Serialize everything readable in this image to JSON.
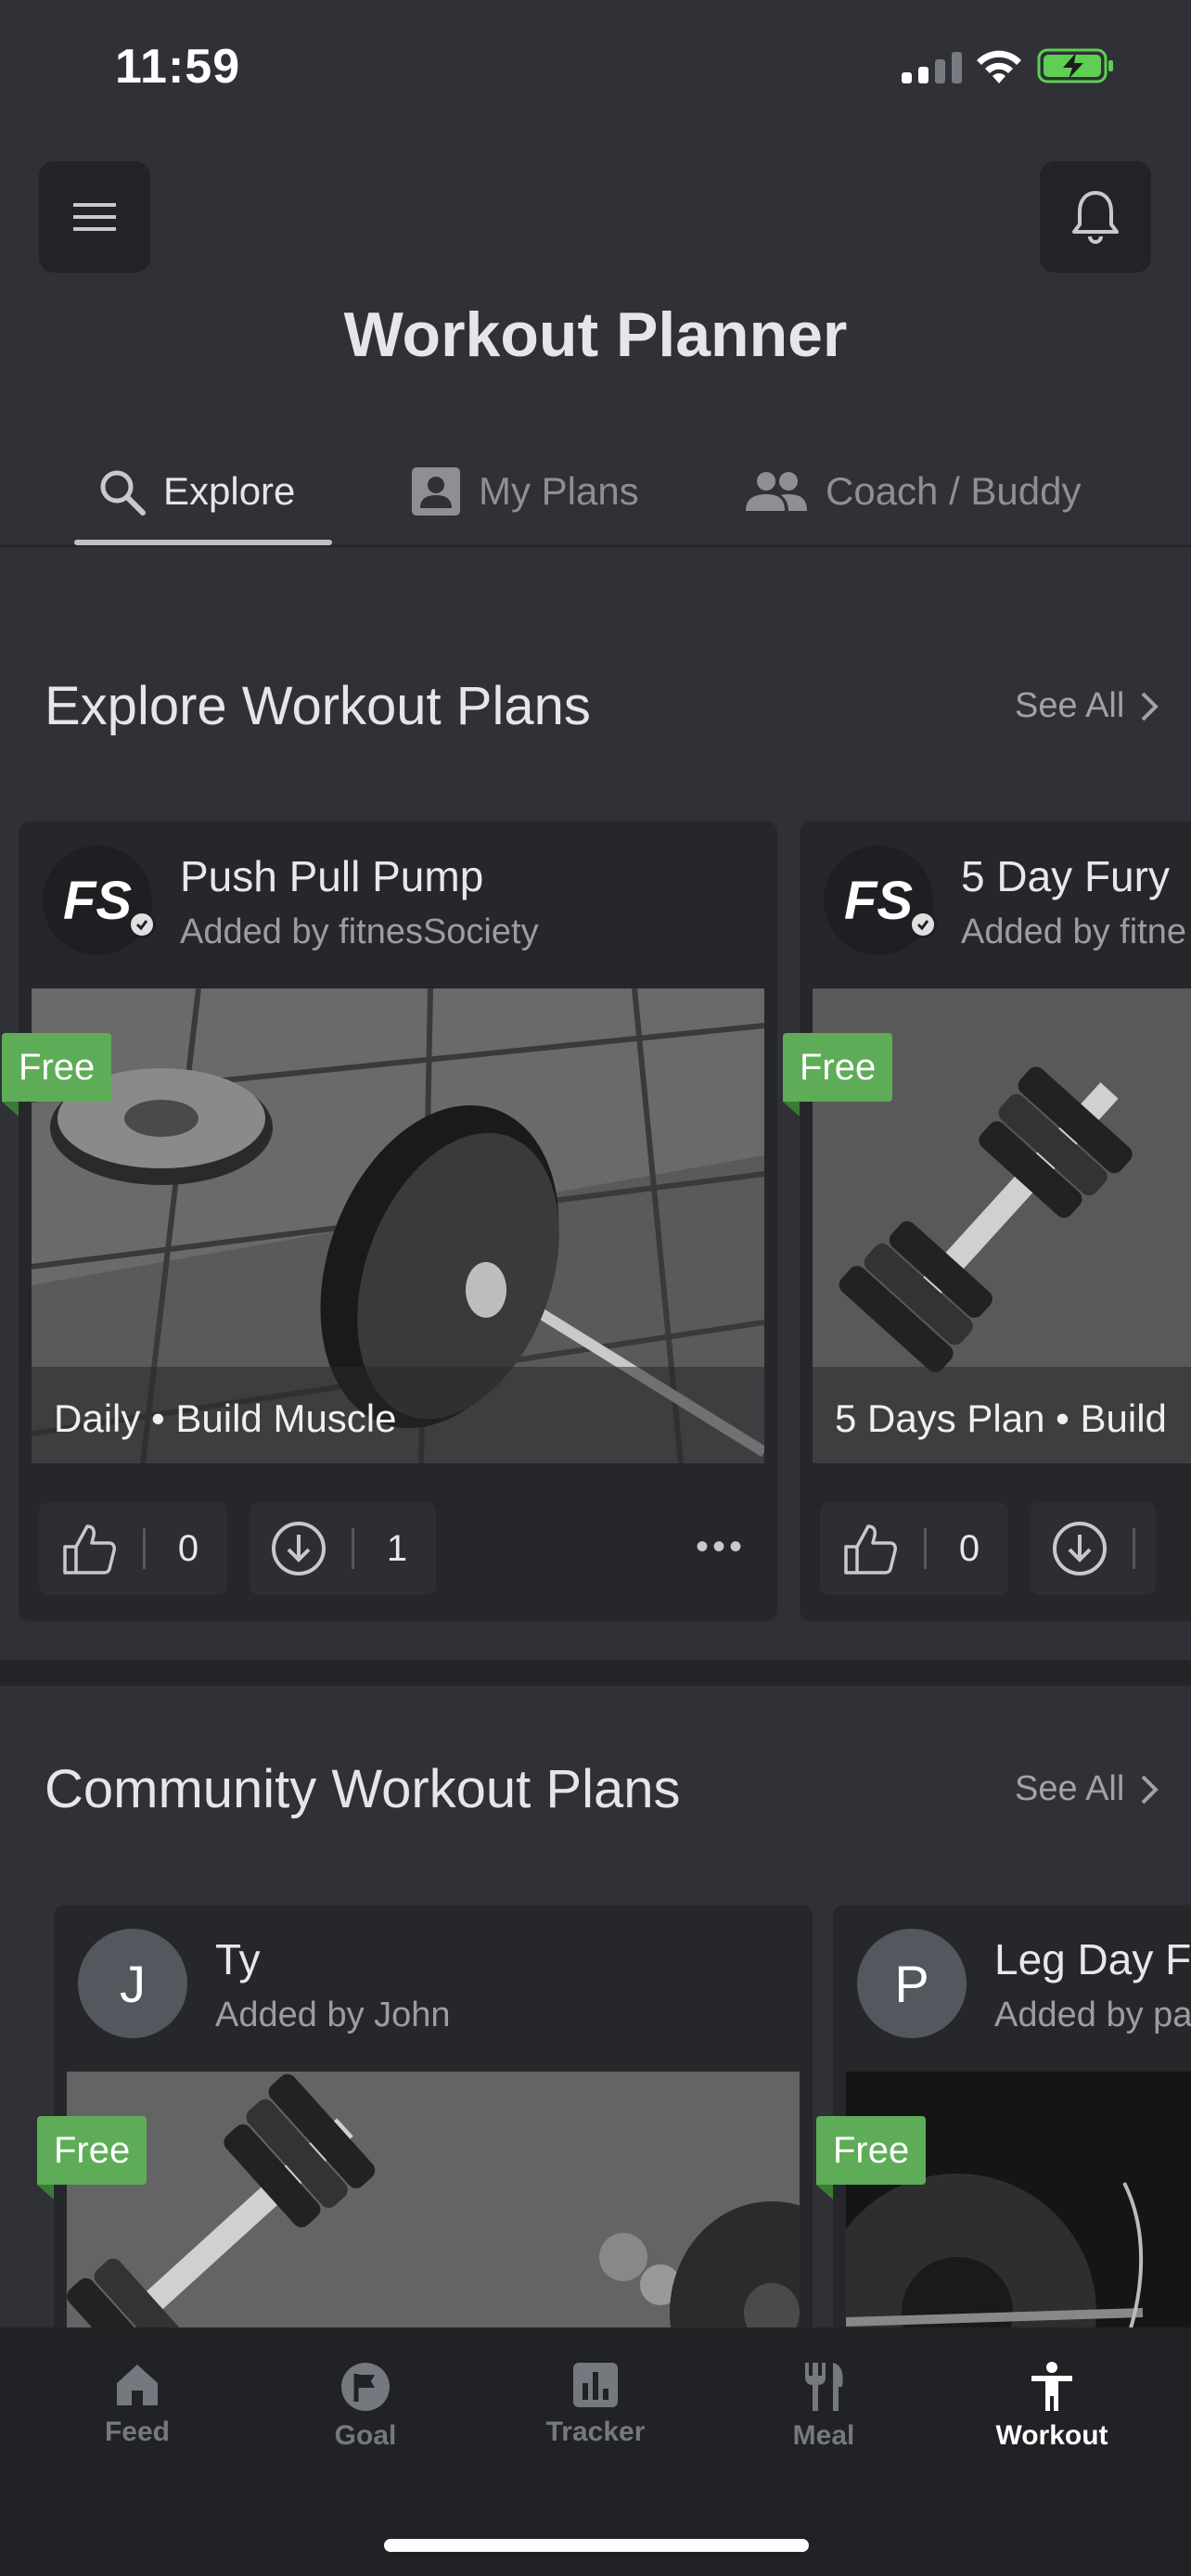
{
  "status_bar": {
    "time": "11:59"
  },
  "header": {
    "title": "Workout Planner"
  },
  "tabs": [
    {
      "label": "Explore",
      "icon": "search-icon",
      "active": true
    },
    {
      "label": "My Plans",
      "icon": "person-card-icon",
      "active": false
    },
    {
      "label": "Coach / Buddy",
      "icon": "people-icon",
      "active": false
    }
  ],
  "sections": {
    "explore": {
      "title": "Explore Workout Plans",
      "see_all": "See All"
    },
    "community": {
      "title": "Community Workout Plans",
      "see_all": "See All"
    }
  },
  "explore_cards": [
    {
      "avatar": "FS",
      "title": "Push Pull Pump",
      "subtitle": "Added by fitnesSociety",
      "tag": "Free",
      "caption": "Daily • Build Muscle",
      "likes": "0",
      "downloads": "1"
    },
    {
      "avatar": "FS",
      "title": "5 Day Fury",
      "subtitle": "Added by fitne",
      "tag": "Free",
      "caption": "5 Days Plan • Build",
      "likes": "0"
    }
  ],
  "community_cards": [
    {
      "avatar": "J",
      "title": "Ty",
      "subtitle": "Added by John",
      "tag": "Free"
    },
    {
      "avatar": "P",
      "title": "Leg Day F",
      "subtitle": "Added by pa",
      "tag": "Free"
    }
  ],
  "bottom_nav": [
    {
      "label": "Feed",
      "icon": "home-icon",
      "active": false
    },
    {
      "label": "Goal",
      "icon": "flag-icon",
      "active": false
    },
    {
      "label": "Tracker",
      "icon": "bar-chart-icon",
      "active": false
    },
    {
      "label": "Meal",
      "icon": "fork-knife-icon",
      "active": false
    },
    {
      "label": "Workout",
      "icon": "person-icon",
      "active": true
    }
  ],
  "colors": {
    "background": "#2f3136",
    "card": "#26272b",
    "free_tag": "#5eac57",
    "nav_active": "#ffffff",
    "nav_inactive": "#75787e"
  }
}
